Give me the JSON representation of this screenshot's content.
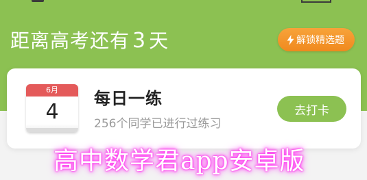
{
  "header": {
    "countdown_prefix": "距离高考还有",
    "countdown_days": "3",
    "countdown_unit": "天",
    "unlock_button_label": "解锁精选题",
    "unlock_icon": "lightning-icon"
  },
  "daily_card": {
    "calendar_month": "6月",
    "calendar_day": "4",
    "title": "每日一练",
    "subtitle": "256个同学已进行过练习",
    "go_button_label": "去打卡"
  },
  "watermark": {
    "text": "高中数学君app安卓版"
  },
  "colors": {
    "brand_green": "#8cc152",
    "unlock_orange": "#f0891e",
    "calendar_red": "#e45a5a",
    "watermark_glow": "#ff3df2"
  }
}
